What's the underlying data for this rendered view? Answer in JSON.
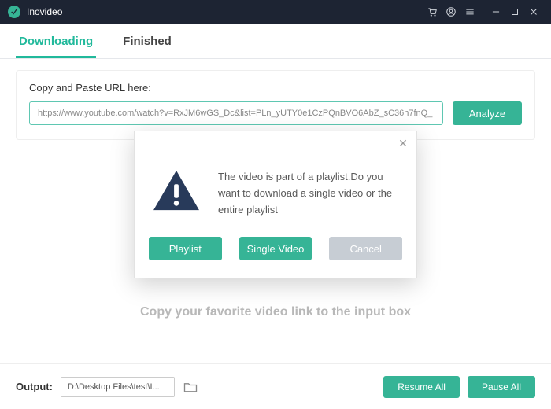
{
  "app": {
    "title": "Inovideo"
  },
  "tabs": {
    "downloading": "Downloading",
    "finished": "Finished"
  },
  "url_card": {
    "label": "Copy and Paste URL here:",
    "url": "https://www.youtube.com/watch?v=RxJM6wGS_Dc&list=PLn_yUTY0e1CzPQnBVO6AbZ_sC36h7fnQ_",
    "analyze": "Analyze"
  },
  "hint": "Copy your favorite video link to the input box",
  "footer": {
    "output_label": "Output:",
    "output_path": "D:\\Desktop Files\\test\\I...",
    "resume": "Resume All",
    "pause": "Pause All"
  },
  "modal": {
    "message": "The video is part of a playlist.Do you want to download a single video or the entire playlist",
    "playlist": "Playlist",
    "single": "Single Video",
    "cancel": "Cancel"
  }
}
